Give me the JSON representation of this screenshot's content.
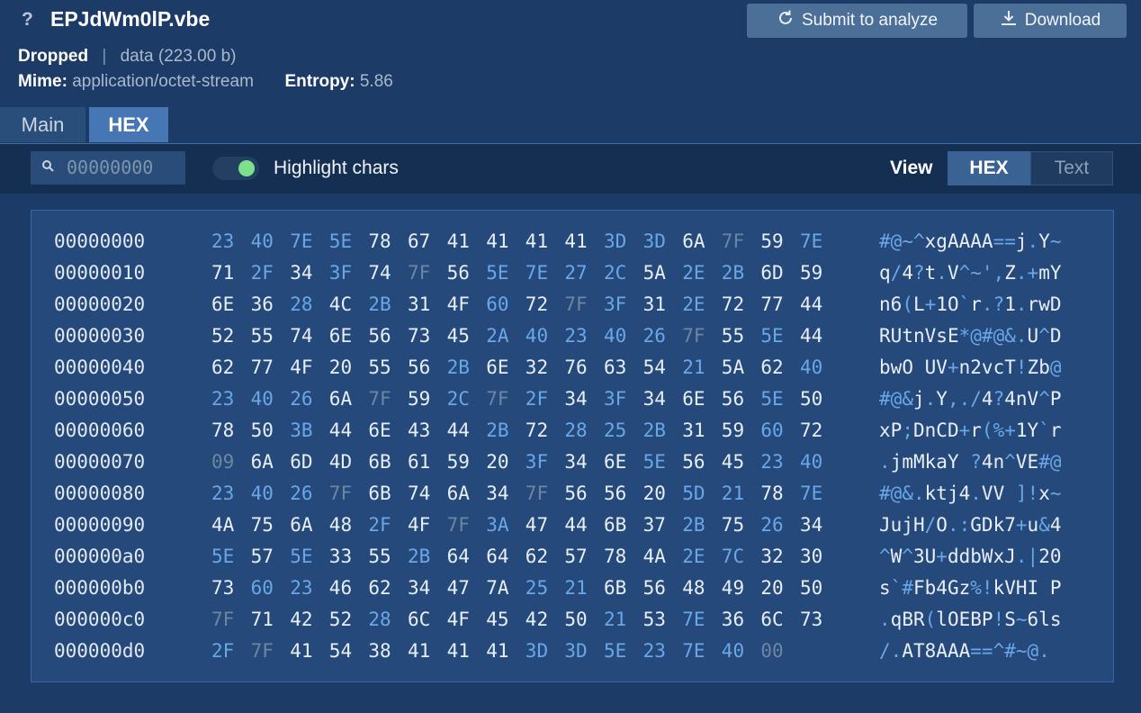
{
  "header": {
    "title": "EPJdWm0lP.vbe",
    "status": "Dropped",
    "type_info": "data (223.00 b)",
    "mime_label": "Mime:",
    "mime_value": "application/octet-stream",
    "entropy_label": "Entropy:",
    "entropy_value": "5.86",
    "submit_label": "Submit to analyze",
    "download_label": "Download"
  },
  "tabs": [
    {
      "label": "Main",
      "active": false
    },
    {
      "label": "HEX",
      "active": true
    }
  ],
  "toolbar": {
    "search_placeholder": "00000000",
    "highlight_label": "Highlight chars",
    "highlight_on": true,
    "view_label": "View",
    "view_options": [
      "HEX",
      "Text"
    ],
    "view_selected": "HEX"
  },
  "colors": {
    "background": "#1c3b66",
    "accent": "#4676b3",
    "highlight_char": "#6aa7e8",
    "toggle_on": "#7de08a"
  },
  "hex": {
    "rows": [
      {
        "offset": "00000000",
        "bytes": [
          "23",
          "40",
          "7E",
          "5E",
          "78",
          "67",
          "41",
          "41",
          "41",
          "41",
          "3D",
          "3D",
          "6A",
          "7F",
          "59",
          "7E"
        ],
        "ascii": "#@~^xgAAAA==j.Y~"
      },
      {
        "offset": "00000010",
        "bytes": [
          "71",
          "2F",
          "34",
          "3F",
          "74",
          "7F",
          "56",
          "5E",
          "7E",
          "27",
          "2C",
          "5A",
          "2E",
          "2B",
          "6D",
          "59"
        ],
        "ascii": "q/4?t.V^~',Z.+mY"
      },
      {
        "offset": "00000020",
        "bytes": [
          "6E",
          "36",
          "28",
          "4C",
          "2B",
          "31",
          "4F",
          "60",
          "72",
          "7F",
          "3F",
          "31",
          "2E",
          "72",
          "77",
          "44"
        ],
        "ascii": "n6(L+1O`r.?1.rwD"
      },
      {
        "offset": "00000030",
        "bytes": [
          "52",
          "55",
          "74",
          "6E",
          "56",
          "73",
          "45",
          "2A",
          "40",
          "23",
          "40",
          "26",
          "7F",
          "55",
          "5E",
          "44"
        ],
        "ascii": "RUtnVsE*@#@&.U^D"
      },
      {
        "offset": "00000040",
        "bytes": [
          "62",
          "77",
          "4F",
          "20",
          "55",
          "56",
          "2B",
          "6E",
          "32",
          "76",
          "63",
          "54",
          "21",
          "5A",
          "62",
          "40"
        ],
        "ascii": "bwO UV+n2vcT!Zb@"
      },
      {
        "offset": "00000050",
        "bytes": [
          "23",
          "40",
          "26",
          "6A",
          "7F",
          "59",
          "2C",
          "7F",
          "2F",
          "34",
          "3F",
          "34",
          "6E",
          "56",
          "5E",
          "50"
        ],
        "ascii": "#@&j.Y,./4?4nV^P"
      },
      {
        "offset": "00000060",
        "bytes": [
          "78",
          "50",
          "3B",
          "44",
          "6E",
          "43",
          "44",
          "2B",
          "72",
          "28",
          "25",
          "2B",
          "31",
          "59",
          "60",
          "72"
        ],
        "ascii": "xP;DnCD+r(%+1Y`r"
      },
      {
        "offset": "00000070",
        "bytes": [
          "09",
          "6A",
          "6D",
          "4D",
          "6B",
          "61",
          "59",
          "20",
          "3F",
          "34",
          "6E",
          "5E",
          "56",
          "45",
          "23",
          "40"
        ],
        "ascii": ".jmMkaY ?4n^VE#@"
      },
      {
        "offset": "00000080",
        "bytes": [
          "23",
          "40",
          "26",
          "7F",
          "6B",
          "74",
          "6A",
          "34",
          "7F",
          "56",
          "56",
          "20",
          "5D",
          "21",
          "78",
          "7E"
        ],
        "ascii": "#@&.ktj4.VV ]!x~"
      },
      {
        "offset": "00000090",
        "bytes": [
          "4A",
          "75",
          "6A",
          "48",
          "2F",
          "4F",
          "7F",
          "3A",
          "47",
          "44",
          "6B",
          "37",
          "2B",
          "75",
          "26",
          "34"
        ],
        "ascii": "JujH/O.:GDk7+u&4"
      },
      {
        "offset": "000000a0",
        "bytes": [
          "5E",
          "57",
          "5E",
          "33",
          "55",
          "2B",
          "64",
          "64",
          "62",
          "57",
          "78",
          "4A",
          "2E",
          "7C",
          "32",
          "30"
        ],
        "ascii": "^W^3U+ddbWxJ.|20"
      },
      {
        "offset": "000000b0",
        "bytes": [
          "73",
          "60",
          "23",
          "46",
          "62",
          "34",
          "47",
          "7A",
          "25",
          "21",
          "6B",
          "56",
          "48",
          "49",
          "20",
          "50"
        ],
        "ascii": "s`#Fb4Gz%!kVHI P"
      },
      {
        "offset": "000000c0",
        "bytes": [
          "7F",
          "71",
          "42",
          "52",
          "28",
          "6C",
          "4F",
          "45",
          "42",
          "50",
          "21",
          "53",
          "7E",
          "36",
          "6C",
          "73"
        ],
        "ascii": ".qBR(lOEBP!S~6ls"
      },
      {
        "offset": "000000d0",
        "bytes": [
          "2F",
          "7F",
          "41",
          "54",
          "38",
          "41",
          "41",
          "41",
          "3D",
          "3D",
          "5E",
          "23",
          "7E",
          "40",
          "00"
        ],
        "ascii": "/.AT8AAA==^#~@."
      }
    ]
  }
}
